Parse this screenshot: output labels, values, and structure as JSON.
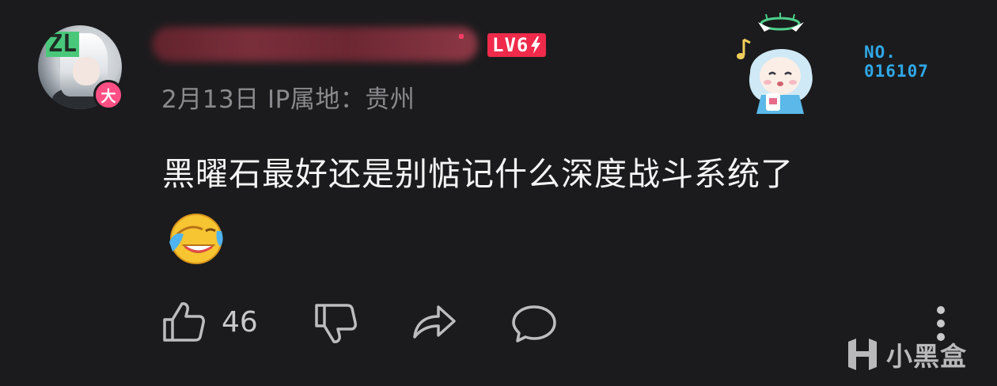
{
  "author": {
    "avatar_icon": "anime-avatar-icon",
    "avatar_mark": "ZL",
    "badge": "大",
    "level": "LV6"
  },
  "meta": "2月13日 IP属地：贵州",
  "decoration": {
    "id_line1": "NO.",
    "id_line2": "016107"
  },
  "comment": {
    "text": "黑曜石最好还是别惦记什么深度战斗系统了",
    "emoji": "laughing-tears-emoji"
  },
  "actions": {
    "like_count": "46"
  },
  "watermark": {
    "text": "小黑盒"
  },
  "colors": {
    "background": "#1b1b1d",
    "level_badge": "#ef2a4a",
    "badge_pink": "#ff4f84",
    "meta_text": "#8a8a8e",
    "deco_id": "#2fa7e6"
  }
}
